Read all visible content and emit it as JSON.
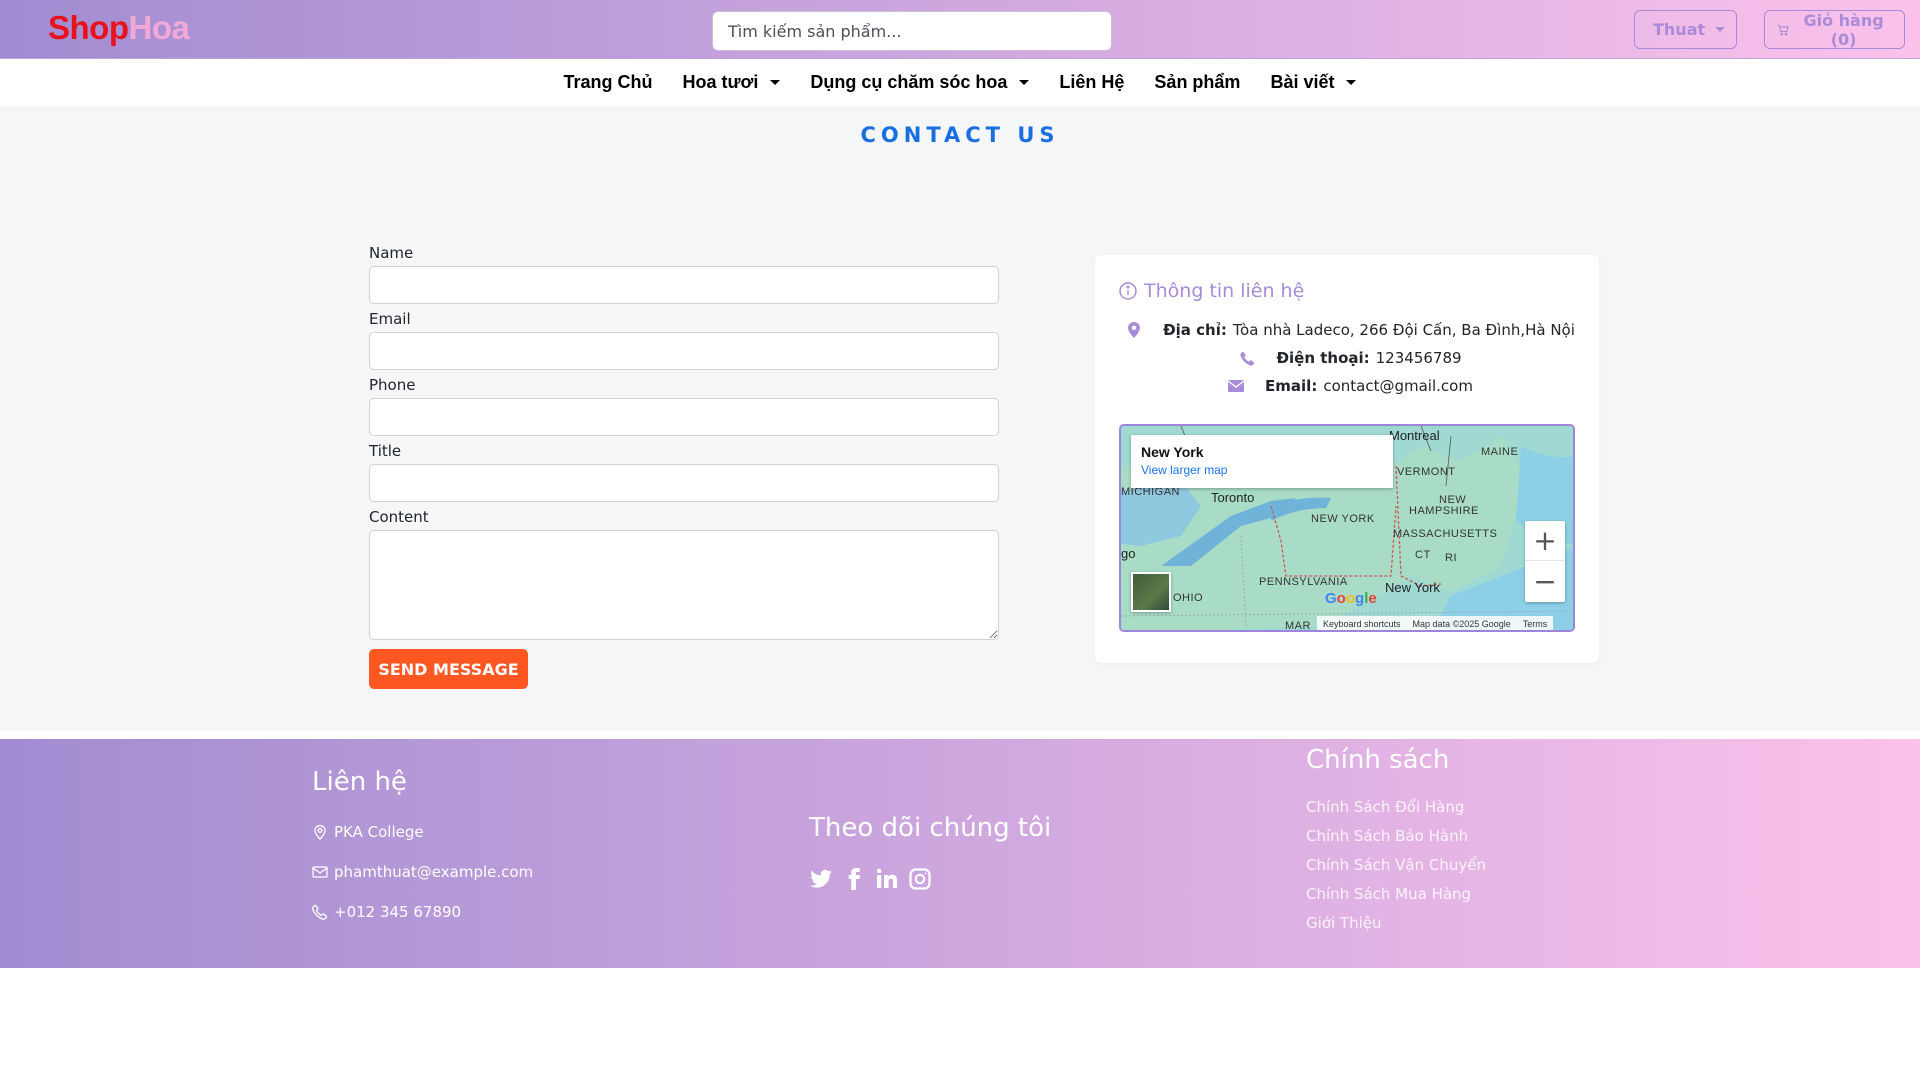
{
  "header": {
    "logo_part1": "Shop",
    "logo_part2": "Hoa",
    "search_placeholder": "Tìm kiếm sản phẩm...",
    "user_label": "Thuat",
    "cart_label": "Giỏ hàng (0)"
  },
  "nav": {
    "items": [
      {
        "label": "Trang Chủ",
        "dropdown": false
      },
      {
        "label": "Hoa tươi",
        "dropdown": true
      },
      {
        "label": "Dụng cụ chăm sóc hoa",
        "dropdown": true
      },
      {
        "label": "Liên Hệ",
        "dropdown": false
      },
      {
        "label": "Sản phẩm",
        "dropdown": false
      },
      {
        "label": "Bài viết",
        "dropdown": true
      }
    ]
  },
  "page": {
    "title": "CONTACT US"
  },
  "form": {
    "name_label": "Name",
    "email_label": "Email",
    "phone_label": "Phone",
    "title_label": "Title",
    "content_label": "Content",
    "submit_label": "SEND MESSAGE"
  },
  "info": {
    "title": "Thông tin liên hệ",
    "address_label": "Địa chỉ:",
    "address_value": "Tòa nhà Ladeco, 266 Đội Cấn, Ba Đình,Hà Nội",
    "phone_label": "Điện thoại:",
    "phone_value": "123456789",
    "email_label": "Email:",
    "email_value": "contact@gmail.com"
  },
  "map": {
    "place": "New York",
    "larger_link": "View larger map",
    "labels": {
      "montreal": "Montreal",
      "maine": "MAINE",
      "vermont": "VERMONT",
      "michigan": "MICHIGAN",
      "toronto": "Toronto",
      "new_hampshire_1": "NEW",
      "new_hampshire_2": "HAMPSHIRE",
      "new_york_state": "NEW YORK",
      "massachusetts": "MASSACHUSETTS",
      "chicago_frag": "go",
      "ct": "CT",
      "ri": "RI",
      "pennsylvania": "PENNSYLVANIA",
      "ohio": "OHIO",
      "new_york_city": "New York",
      "mar_frag": "MAR"
    },
    "google": "Google",
    "footer_shortcuts": "Keyboard shortcuts",
    "footer_data": "Map data ©2025 Google",
    "footer_terms": "Terms",
    "zoom_in": "+",
    "zoom_out": "−"
  },
  "footer": {
    "contact_heading": "Liên hệ",
    "address": "PKA College",
    "email": "phamthuat@example.com",
    "phone": "+012 345 67890",
    "follow_heading": "Theo dõi chúng tôi",
    "social_icons": [
      "twitter-icon",
      "facebook-icon",
      "linkedin-icon",
      "instagram-icon"
    ],
    "policy_heading": "Chính sách",
    "policies": [
      "Chính Sách Đổi Hàng",
      "Chính Sách Bảo Hành",
      "Chính Sách Vận Chuyển",
      "Chính Sách Mua Hàng",
      "Giới Thiệu"
    ]
  },
  "colors": {
    "gradient_start": "#a18cd1",
    "gradient_end": "#fbc2eb",
    "accent_purple": "#a98bd8",
    "send_button": "#ff5722",
    "title_blue": "#1a6fe0",
    "logo_red": "#e8111c",
    "logo_pink": "#f3a9d8"
  }
}
